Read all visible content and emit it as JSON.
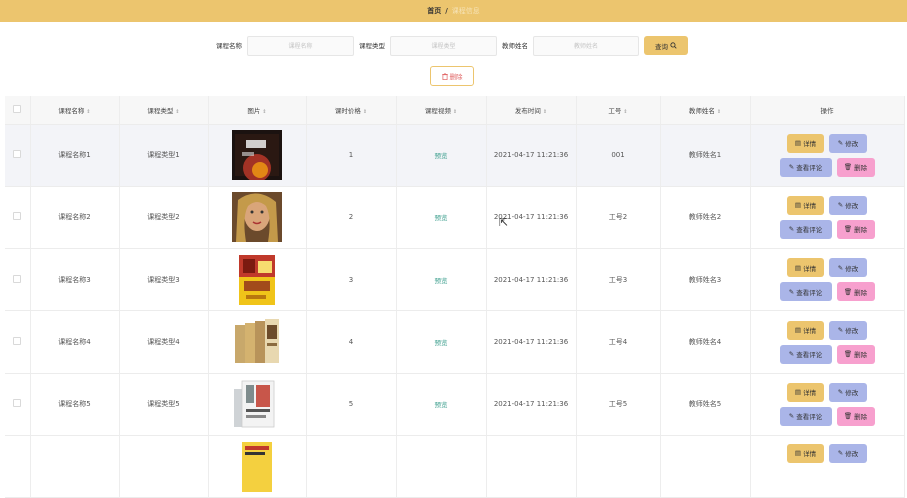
{
  "breadcrumb": {
    "home": "首页",
    "separator": "/",
    "current": "课程信息"
  },
  "search": {
    "course_name_label": "课程名称",
    "course_name_placeholder": "课程名称",
    "course_type_label": "课程类型",
    "course_type_placeholder": "课程类型",
    "teacher_name_label": "教师姓名",
    "teacher_name_placeholder": "教师姓名",
    "query_label": "查询"
  },
  "toolbar": {
    "delete_label": "删除"
  },
  "table": {
    "headers": [
      "课程名称",
      "课程类型",
      "图片",
      "课时价格",
      "课程视频",
      "发布时间",
      "工号",
      "教师姓名",
      "操作"
    ],
    "rows": [
      {
        "name": "课程名称1",
        "type": "课程类型1",
        "price": "1",
        "video": "预览",
        "time": "2021-04-17 11:21:36",
        "no": "001",
        "teacher": "教师姓名1"
      },
      {
        "name": "课程名称2",
        "type": "课程类型2",
        "price": "2",
        "video": "预览",
        "time": "2021-04-17 11:21:36",
        "no": "工号2",
        "teacher": "教师姓名2"
      },
      {
        "name": "课程名称3",
        "type": "课程类型3",
        "price": "3",
        "video": "预览",
        "time": "2021-04-17 11:21:36",
        "no": "工号3",
        "teacher": "教师姓名3"
      },
      {
        "name": "课程名称4",
        "type": "课程类型4",
        "price": "4",
        "video": "预览",
        "time": "2021-04-17 11:21:36",
        "no": "工号4",
        "teacher": "教师姓名4"
      },
      {
        "name": "课程名称5",
        "type": "课程类型5",
        "price": "5",
        "video": "预览",
        "time": "2021-04-17 11:21:36",
        "no": "工号5",
        "teacher": "教师姓名5"
      }
    ],
    "actions": {
      "detail": "详情",
      "edit": "修改",
      "review": "查看评论",
      "delete": "删除"
    }
  },
  "colors": {
    "accent": "#ecc56e",
    "edit": "#aab5e8",
    "delete": "#f7a0ce",
    "preview": "#3d9f8e"
  }
}
